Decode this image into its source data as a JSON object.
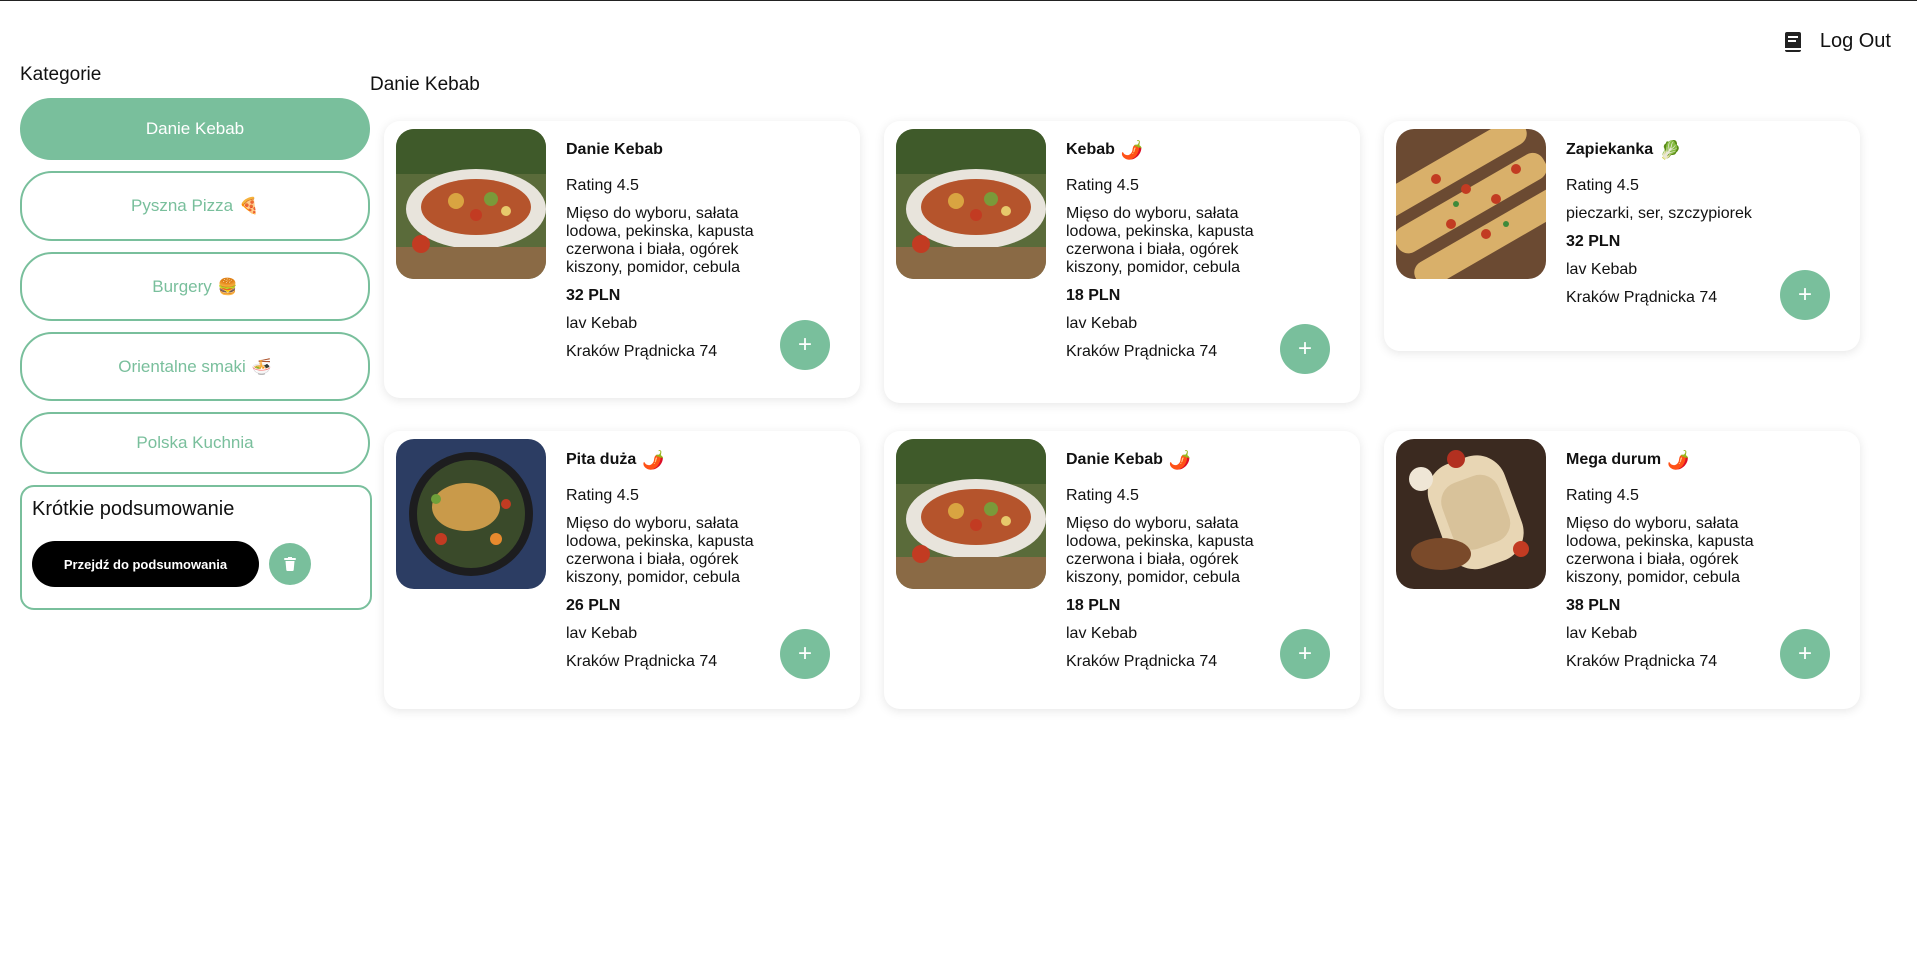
{
  "header": {
    "logout_label": "Log Out"
  },
  "sidebar": {
    "title": "Kategorie",
    "categories": [
      {
        "label": "Danie Kebab",
        "emoji": "",
        "active": true
      },
      {
        "label": "Pyszna Pizza",
        "emoji": "🍕",
        "active": false
      },
      {
        "label": "Burgery",
        "emoji": "🍔",
        "active": false
      },
      {
        "label": "Orientalne smaki",
        "emoji": "🍜",
        "active": false
      },
      {
        "label": "Polska Kuchnia",
        "emoji": "",
        "active": false
      }
    ],
    "summary": {
      "title": "Krótkie podsumowanie",
      "go_label": "Przejdź do podsumowania"
    }
  },
  "main": {
    "title": "Danie Kebab",
    "items": [
      {
        "name": "Danie Kebab",
        "badge": "",
        "rating": "Rating 4.5",
        "desc": "Mięso do wyboru, sałata lodowa, pekinska, kapusta czerwona i biała, ogórek kiszony, pomidor, cebula",
        "price": "32 PLN",
        "restaurant": "lav Kebab",
        "address": "Kraków Prądnicka 74",
        "image": "kebab-plate"
      },
      {
        "name": "Kebab",
        "badge": "🌶️",
        "rating": "Rating 4.5",
        "desc": "Mięso do wyboru, sałata lodowa, pekinska, kapusta czerwona i biała, ogórek kiszony, pomidor, cebula",
        "price": "18 PLN",
        "restaurant": "lav Kebab",
        "address": "Kraków Prądnicka 74",
        "image": "kebab-plate"
      },
      {
        "name": "Zapiekanka",
        "badge": "🥬",
        "rating": "Rating 4.5",
        "desc": "pieczarki, ser, szczypiorek",
        "price": "32 PLN",
        "restaurant": "lav Kebab",
        "address": "Kraków Prądnicka 74",
        "image": "zapiekanka"
      },
      {
        "name": "Pita duża",
        "badge": "🌶️",
        "rating": "Rating 4.5",
        "desc": "Mięso do wyboru, sałata lodowa, pekinska, kapusta czerwona i biała, ogórek kiszony, pomidor, cebula",
        "price": "26 PLN",
        "restaurant": "lav Kebab",
        "address": "Kraków Prądnicka 74",
        "image": "pita-bowl"
      },
      {
        "name": "Danie Kebab",
        "badge": "🌶️",
        "rating": "Rating 4.5",
        "desc": "Mięso do wyboru, sałata lodowa, pekinska, kapusta czerwona i biała, ogórek kiszony, pomidor, cebula",
        "price": "18 PLN",
        "restaurant": "lav Kebab",
        "address": "Kraków Prądnicka 74",
        "image": "kebab-plate"
      },
      {
        "name": "Mega durum",
        "badge": "🌶️",
        "rating": "Rating 4.5",
        "desc": "Mięso do wyboru, sałata lodowa, pekinska, kapusta czerwona i biała, ogórek kiszony, pomidor, cebula",
        "price": "38 PLN",
        "restaurant": "lav Kebab",
        "address": "Kraków Prądnicka 74",
        "image": "durum-wrap"
      }
    ]
  },
  "colors": {
    "accent": "#79bf9c",
    "button_dark": "#000000"
  },
  "icons": {
    "logout": "book-icon",
    "trash": "trash-icon",
    "add": "plus-icon"
  }
}
